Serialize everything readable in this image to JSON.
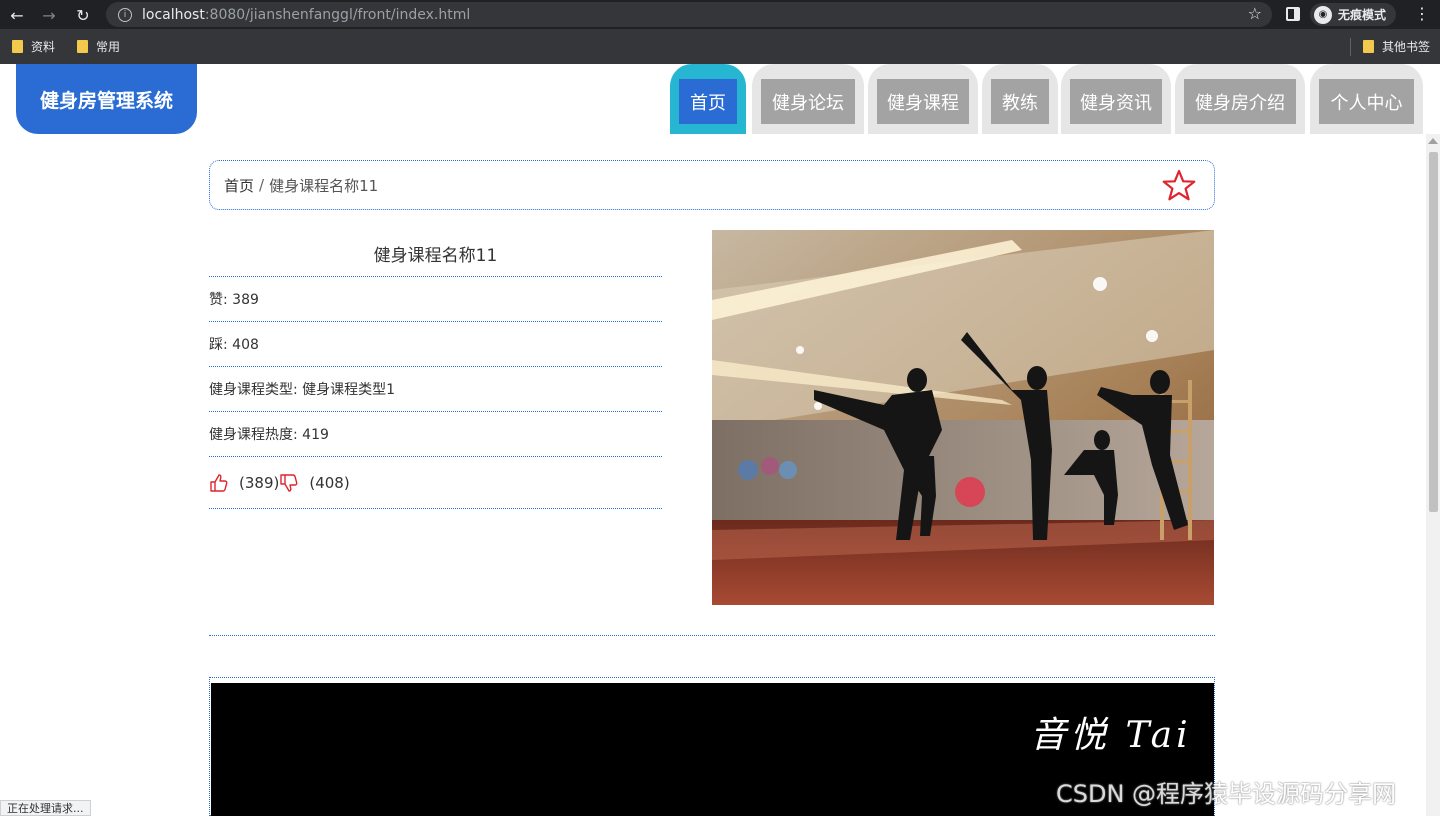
{
  "browser": {
    "url_host": "localhost",
    "url_path": ":8080/jianshenfanggl/front/index.html",
    "incognito_label": "无痕模式",
    "bookmarks": [
      "资料",
      "常用"
    ],
    "other_bookmarks": "其他书签",
    "status_text": "正在处理请求..."
  },
  "site": {
    "logo": "健身房管理系统",
    "nav": [
      "首页",
      "健身论坛",
      "健身课程",
      "教练",
      "健身资讯",
      "健身房介绍",
      "个人中心"
    ],
    "active_nav": "首页"
  },
  "breadcrumb": {
    "home": "首页",
    "separator": "/",
    "current": "健身课程名称11"
  },
  "course": {
    "title": "健身课程名称11",
    "fields": [
      {
        "label": "赞: 389"
      },
      {
        "label": "踩: 408"
      },
      {
        "label": "健身课程类型: 健身课程类型1"
      },
      {
        "label": "健身课程热度: 419"
      }
    ],
    "likes": "(389)",
    "dislikes": "(408)"
  },
  "video": {
    "caption": "音悦 Tai"
  },
  "watermark": "CSDN @程序猿毕设源码分享网",
  "colors": {
    "primary": "#2a6cd4",
    "active_tab_border": "#26b6d2",
    "inactive_tab": "#a3a3a3",
    "star": "#e0242e",
    "thumb": "#e0242e"
  }
}
